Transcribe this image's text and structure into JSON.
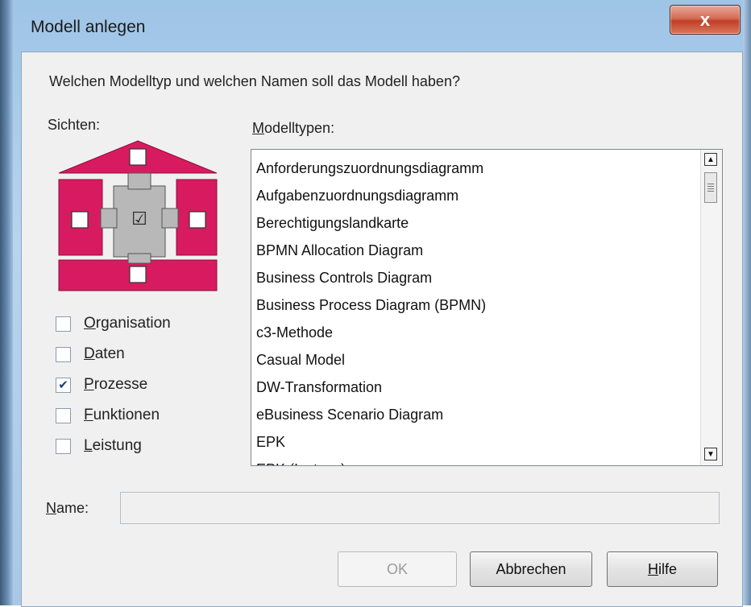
{
  "window": {
    "title": "Modell anlegen",
    "close_label": "x"
  },
  "dialog": {
    "question": "Welchen Modelltyp und welchen Namen soll das Modell haben?",
    "views_label": "Sichten:",
    "types_label_accel": "M",
    "types_label_rest": "odelltypen:"
  },
  "house_icon": {
    "accent_color": "#d81b60",
    "center_check": "☑"
  },
  "views": [
    {
      "accel": "O",
      "rest": "rganisation",
      "checked": false,
      "check_glyph": ""
    },
    {
      "accel": "D",
      "rest": "aten",
      "checked": false,
      "check_glyph": ""
    },
    {
      "accel": "P",
      "rest": "rozesse",
      "checked": true,
      "check_glyph": "✔"
    },
    {
      "accel": "F",
      "rest": "unktionen",
      "checked": false,
      "check_glyph": ""
    },
    {
      "accel": "L",
      "rest": "eistung",
      "checked": false,
      "check_glyph": ""
    }
  ],
  "model_types": [
    "Anforderungszuordnungsdiagramm",
    "Aufgabenzuordnungsdiagramm",
    "Berechtigungslandkarte",
    "BPMN Allocation Diagram",
    "Business Controls Diagram",
    "Business Process Diagram (BPMN)",
    "c3-Methode",
    "Casual Model",
    "DW-Transformation",
    "eBusiness Scenario Diagram",
    "EPK",
    "EPK (Instanz)"
  ],
  "scrollbar": {
    "up_glyph": "▲",
    "down_glyph": "▼"
  },
  "name": {
    "label_accel": "N",
    "label_rest": "ame:",
    "value": ""
  },
  "buttons": {
    "ok": "OK",
    "cancel": "Abbrechen",
    "help_accel": "H",
    "help_rest": "ilfe"
  }
}
